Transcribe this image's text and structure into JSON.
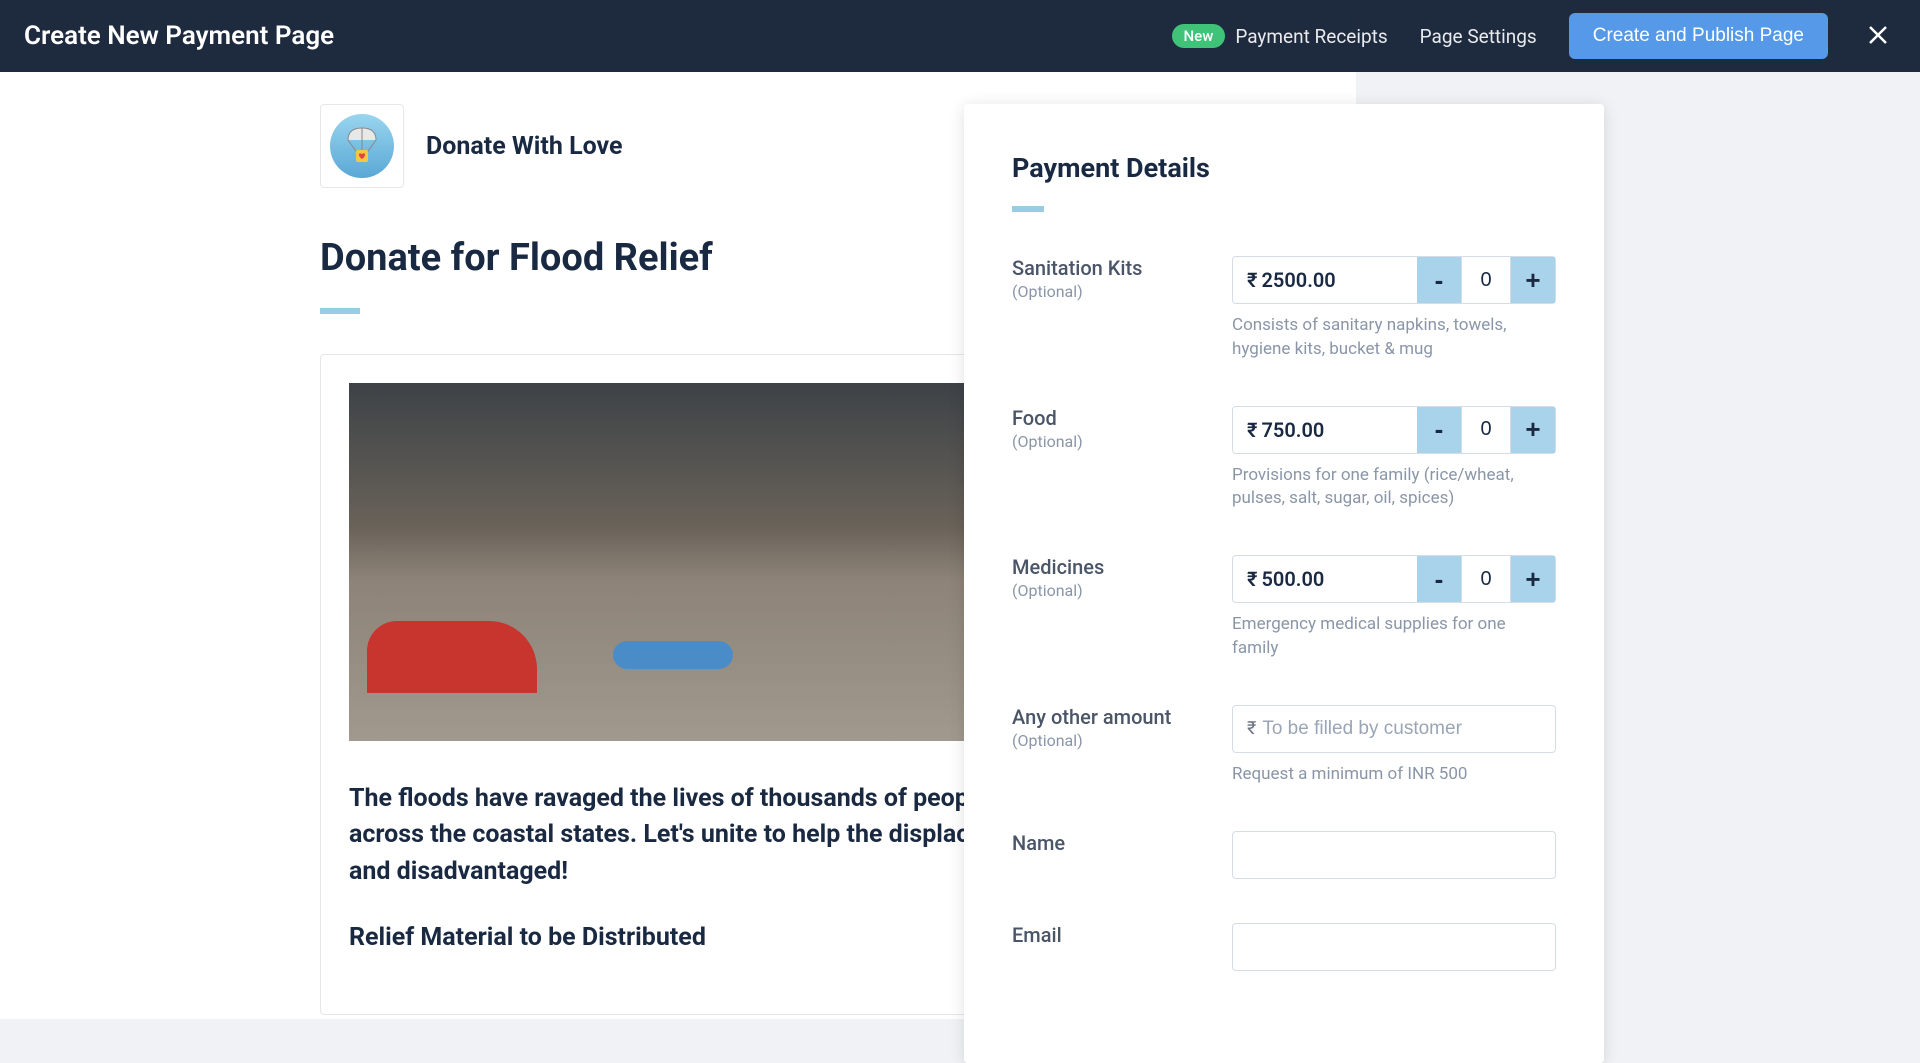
{
  "header": {
    "title": "Create New Payment Page",
    "new_badge": "New",
    "receipts_label": "Payment Receipts",
    "settings_label": "Page Settings",
    "publish_label": "Create and Publish Page"
  },
  "brand": {
    "name": "Donate With Love"
  },
  "page": {
    "heading": "Donate for Flood Relief",
    "body_text": "The floods have ravaged the lives of thousands of people across the coastal states. Let's unite to help the displaced and disadvantaged!",
    "subheading": "Relief Material to be Distributed"
  },
  "payment": {
    "title": "Payment Details",
    "currency": "₹",
    "items": [
      {
        "name": "Sanitation Kits",
        "optional": "(Optional)",
        "price": "2500.00",
        "qty": "0",
        "desc": "Consists of sanitary napkins, towels, hygiene kits, bucket & mug"
      },
      {
        "name": "Food",
        "optional": "(Optional)",
        "price": "750.00",
        "qty": "0",
        "desc": "Provisions for one family (rice/wheat, pulses, salt, sugar, oil, spices)"
      },
      {
        "name": "Medicines",
        "optional": "(Optional)",
        "price": "500.00",
        "qty": "0",
        "desc": "Emergency medical supplies for one family"
      }
    ],
    "other_amount": {
      "label": "Any other amount",
      "optional": "(Optional)",
      "placeholder": "To be filled by customer",
      "hint": "Request a minimum of INR 500"
    },
    "fields": {
      "name_label": "Name",
      "email_label": "Email"
    }
  }
}
